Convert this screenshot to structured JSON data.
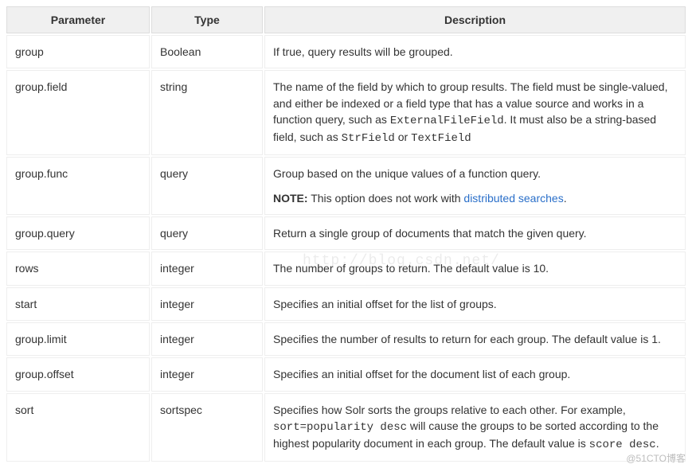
{
  "headers": {
    "parameter": "Parameter",
    "type": "Type",
    "description": "Description"
  },
  "rows": [
    {
      "param": "group",
      "type": "Boolean",
      "desc_plain": "If true, query results will be grouped."
    },
    {
      "param": "group.field",
      "type": "string",
      "desc_parts": {
        "t1": "The name of the field by which to group results. The field must be single-valued, and either be indexed or a field type that has a value source and works in a function query, such as ",
        "c1": "ExternalFileField",
        "t2": ". It must also be a string-based field, such as ",
        "c2": "StrField",
        "t3": " or ",
        "c3": "TextField"
      }
    },
    {
      "param": "group.func",
      "type": "query",
      "desc_parts": {
        "p1": "Group based on the unique values of a function query.",
        "note_label": "NOTE:",
        "note_text": " This option does not work with ",
        "note_link": "distributed searches",
        "note_after": "."
      }
    },
    {
      "param": "group.query",
      "type": "query",
      "desc_plain": "Return a single group of documents that match the given query."
    },
    {
      "param": "rows",
      "type": "integer",
      "desc_plain": "The number of groups to return. The default value is 10."
    },
    {
      "param": "start",
      "type": "integer",
      "desc_plain": "Specifies an initial offset for the list of groups."
    },
    {
      "param": "group.limit",
      "type": "integer",
      "desc_plain": "Specifies the number of results to return for each group. The default value is 1."
    },
    {
      "param": "group.offset",
      "type": "integer",
      "desc_plain": "Specifies an initial offset for the document list of each group."
    },
    {
      "param": "sort",
      "type": "sortspec",
      "desc_parts": {
        "t1": "Specifies how Solr sorts the groups relative to each other. For example, ",
        "c1": "sort=popularity desc",
        "t2": " will cause the groups to be sorted according to the highest popularity document in each group. The default value is ",
        "c2": "score desc",
        "t3": "."
      }
    }
  ],
  "watermarks": {
    "blog": "http://blog.csdn.net/",
    "footer": "@51CTO博客"
  }
}
